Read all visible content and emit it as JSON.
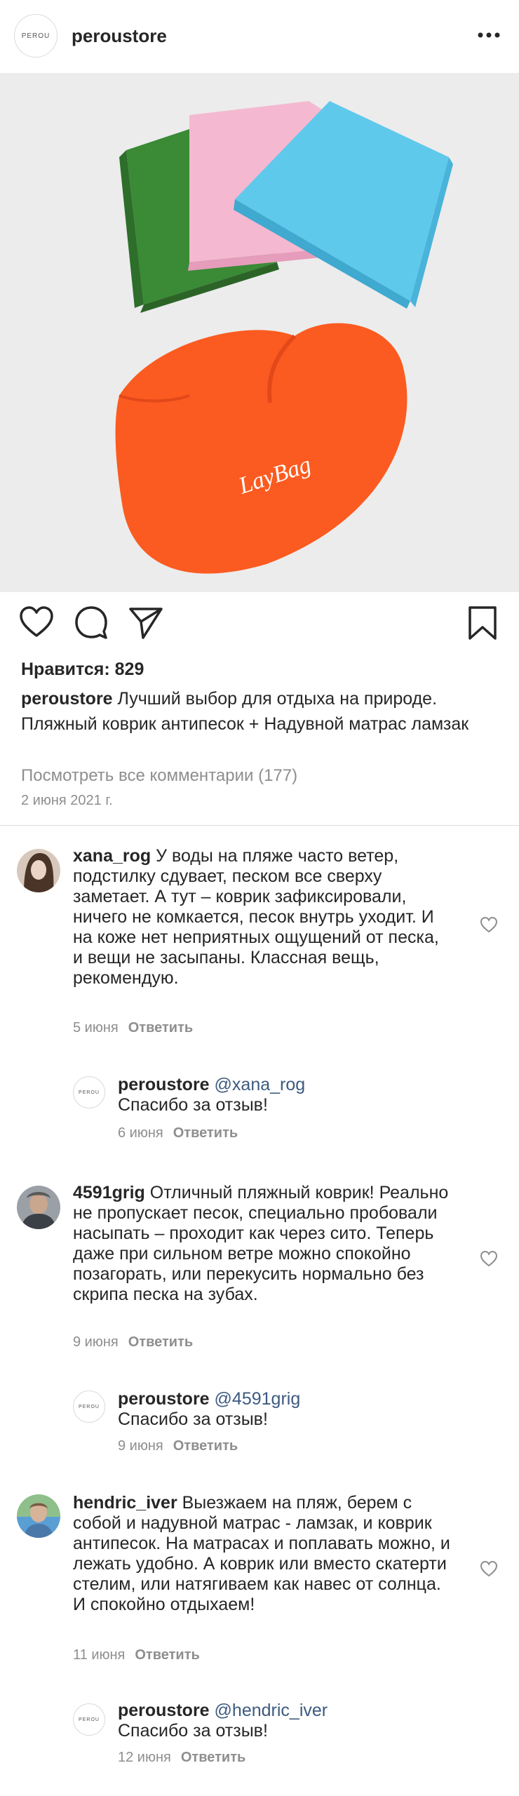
{
  "header": {
    "avatar_text": "PEROU",
    "username": "peroustore"
  },
  "post": {
    "image_brand_text": "LayBag",
    "likes": "Нравится: 829",
    "caption_user": "peroustore",
    "caption_text": " Лучший выбор для отдыха на природе. Пляжный коврик антипесок + Надувной матрас ламзак",
    "view_all": "Посмотреть все комментарии (177)",
    "date": "2 июня 2021 г."
  },
  "comments": [
    {
      "user": "xana_rog",
      "text": " У воды на пляже часто ветер, подстилку сдувает, песком все сверху заметает. А тут – коврик зафиксировали, ничего не комкается, песок внутрь уходит. И на коже нет неприятных ощущений от песка, и вещи не засыпаны. Классная вещь, рекомендую.",
      "date": "5 июня",
      "reply_label": "Ответить",
      "reply": {
        "user": "peroustore",
        "avatar_text": "PEROU",
        "mention": "@xana_rog",
        "text": "Спасибо за отзыв!",
        "date": "6 июня",
        "reply_label": "Ответить"
      }
    },
    {
      "user": "4591grig",
      "text": " Отличный пляжный коврик! Реально не пропускает песок, специально пробовали насыпать – проходит как через сито. Теперь даже при сильном ветре можно спокойно позагорать, или перекусить нормально без скрипа песка на зубах.",
      "date": "9 июня",
      "reply_label": "Ответить",
      "reply": {
        "user": "peroustore",
        "avatar_text": "PEROU",
        "mention": "@4591grig",
        "text": "Спасибо за отзыв!",
        "date": "9 июня",
        "reply_label": "Ответить"
      }
    },
    {
      "user": "hendric_iver",
      "text": "  Выезжаем на пляж, берем с собой и надувной матрас - ламзак, и коврик антипесок. На матрасах и поплавать можно, и лежать удобно. А коврик или вместо скатерти стелим, или натягиваем как навес от солнца. И спокойно отдыхаем!",
      "date": "11 июня",
      "reply_label": "Ответить",
      "reply": {
        "user": "peroustore",
        "avatar_text": "PEROU",
        "mention": "@hendric_iver",
        "text": "Спасибо за отзыв!",
        "date": "12 июня",
        "reply_label": "Ответить"
      }
    }
  ],
  "colors": {
    "text": "#262626",
    "muted": "#8e8e8e",
    "mention": "#3d5a80",
    "mat_green": "#3f8a3a",
    "mat_pink": "#f3b8cf",
    "mat_blue": "#5ec8ea",
    "bag_orange": "#fb5b20"
  }
}
